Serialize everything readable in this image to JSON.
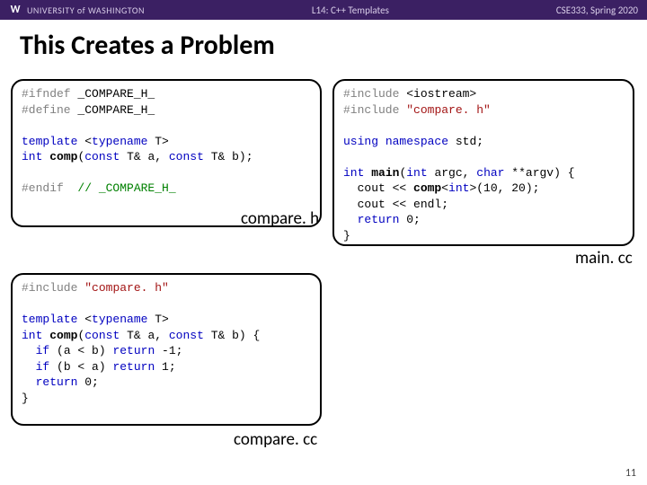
{
  "header": {
    "logo": "W",
    "university": "UNIVERSITY of WASHINGTON",
    "lecture": "L14: C++ Templates",
    "course": "CSE333, Spring 2020"
  },
  "title": "This Creates a Problem",
  "code": {
    "compare_h": {
      "caption": "compare. h",
      "l1a": "#ifndef",
      "l1b": " _COMPARE_H_",
      "l2a": "#define",
      "l2b": " _COMPARE_H_",
      "l3a": "template",
      "l3b": " <",
      "l3c": "typename",
      "l3d": " T>",
      "l4a": "int",
      "l4b": " ",
      "l4c": "comp",
      "l4d": "(",
      "l4e": "const",
      "l4f": " T& a, ",
      "l4g": "const",
      "l4h": " T& b);",
      "l5a": "#endif",
      "l5b": "  ",
      "l5c": "// _COMPARE_H_"
    },
    "main_cc": {
      "caption": "main. cc",
      "l1a": "#include",
      "l1b": " <iostream>",
      "l2a": "#include",
      "l2b": " ",
      "l2c": "\"compare. h\"",
      "l3a": "using",
      "l3b": " ",
      "l3c": "namespace",
      "l3d": " std;",
      "l4a": "int",
      "l4b": " ",
      "l4c": "main",
      "l4d": "(",
      "l4e": "int",
      "l4f": " argc, ",
      "l4g": "char",
      "l4h": " **argv) {",
      "l5": "  cout << ",
      "l5b": "comp",
      "l5c": "<",
      "l5d": "int",
      "l5e": ">(10, 20);",
      "l6": "  cout << endl;",
      "l7a": "  ",
      "l7b": "return",
      "l7c": " 0;",
      "l8": "}"
    },
    "compare_cc": {
      "caption": "compare. cc",
      "l1a": "#include",
      "l1b": " ",
      "l1c": "\"compare. h\"",
      "l2a": "template",
      "l2b": " <",
      "l2c": "typename",
      "l2d": " T>",
      "l3a": "int",
      "l3b": " ",
      "l3c": "comp",
      "l3d": "(",
      "l3e": "const",
      "l3f": " T& a, ",
      "l3g": "const",
      "l3h": " T& b) {",
      "l4a": "  ",
      "l4b": "if",
      "l4c": " (a < b) ",
      "l4d": "return",
      "l4e": " -1;",
      "l5a": "  ",
      "l5b": "if",
      "l5c": " (b < a) ",
      "l5d": "return",
      "l5e": " 1;",
      "l6a": "  ",
      "l6b": "return",
      "l6c": " 0;",
      "l7": "}"
    }
  },
  "pagenum": "11"
}
